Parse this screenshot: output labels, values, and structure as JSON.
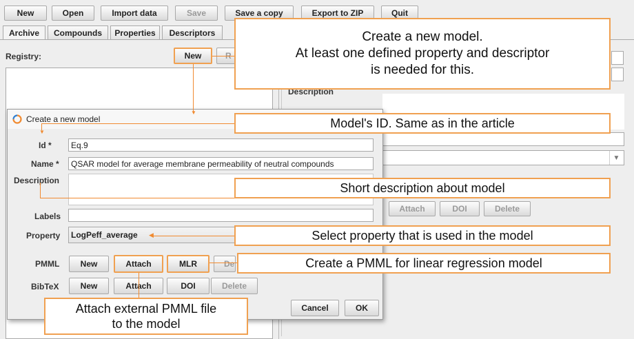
{
  "toolbar": {
    "new": "New",
    "open": "Open",
    "import": "Import data",
    "save": "Save",
    "save_copy": "Save a copy",
    "export_zip": "Export to ZIP",
    "quit": "Quit"
  },
  "tabs": [
    "Archive",
    "Compounds",
    "Properties",
    "Descriptors"
  ],
  "registry": {
    "label": "Registry:",
    "new_button": "New",
    "next_button_partial": "R"
  },
  "right_panel": {
    "description_label": "Description",
    "attach": "Attach",
    "doi": "DOI",
    "delete": "Delete"
  },
  "dialog": {
    "title": "Create a new model",
    "id_label": "Id *",
    "id_value": "Eq.9",
    "name_label": "Name *",
    "name_value": "QSAR model for average membrane permeability of neutral compounds",
    "description_label": "Description",
    "labels_label": "Labels",
    "property_label": "Property",
    "property_value": "LogPeff_average",
    "pmml_label": "PMML",
    "pmml_new": "New",
    "pmml_attach": "Attach",
    "pmml_mlr": "MLR",
    "pmml_delete_partial": "De",
    "bibtex_label": "BibTeX",
    "bibtex_new": "New",
    "bibtex_attach": "Attach",
    "bibtex_doi": "DOI",
    "bibtex_delete": "Delete",
    "cancel": "Cancel",
    "ok": "OK"
  },
  "callouts": {
    "create_model_1": "Create a new model.",
    "create_model_2": "At least one defined property and descriptor",
    "create_model_3": "is needed for this.",
    "model_id": "Model's ID. Same as in the article",
    "short_desc": "Short description about model",
    "select_property": "Select property that is used in the model",
    "create_pmml": "Create a PMML for linear regression model",
    "attach_pmml_1": "Attach external PMML file",
    "attach_pmml_2": "to the model"
  },
  "colors": {
    "accent": "#f0a050",
    "line": "#f08a30",
    "dialog_bg": "#eeeeee"
  }
}
